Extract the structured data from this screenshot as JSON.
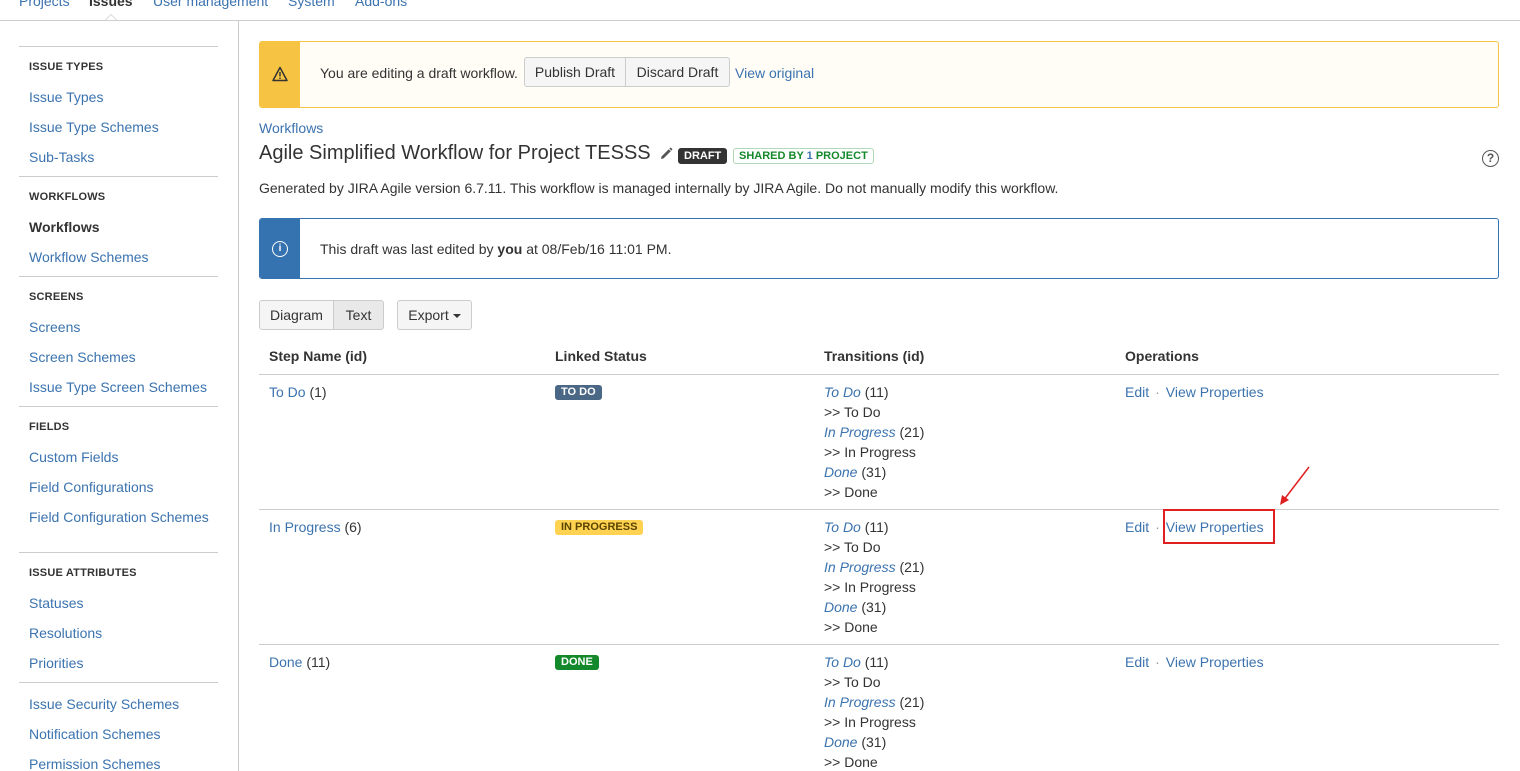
{
  "topnav": {
    "items": [
      "Projects",
      "Issues",
      "User management",
      "System",
      "Add-ons"
    ],
    "active_index": 1
  },
  "sidebar": {
    "sections": [
      {
        "title": "ISSUE TYPES",
        "items": [
          "Issue Types",
          "Issue Type Schemes",
          "Sub-Tasks"
        ]
      },
      {
        "title": "WORKFLOWS",
        "items": [
          "Workflows",
          "Workflow Schemes"
        ],
        "current": "Workflows"
      },
      {
        "title": "SCREENS",
        "items": [
          "Screens",
          "Screen Schemes",
          "Issue Type Screen Schemes"
        ]
      },
      {
        "title": "FIELDS",
        "items": [
          "Custom Fields",
          "Field Configurations",
          "Field Configuration Schemes"
        ]
      },
      {
        "title": "ISSUE ATTRIBUTES",
        "items": [
          "Statuses",
          "Resolutions",
          "Priorities"
        ]
      },
      {
        "title": "",
        "items": [
          "Issue Security Schemes",
          "Notification Schemes",
          "Permission Schemes"
        ]
      }
    ]
  },
  "draft_banner": {
    "message": "You are editing a draft workflow.",
    "publish_label": "Publish Draft",
    "discard_label": "Discard Draft",
    "view_original": "View original",
    "icon": "warning-icon",
    "color": "#f6c342"
  },
  "breadcrumb": "Workflows",
  "page": {
    "title": "Agile Simplified Workflow for Project TESSS",
    "draft_badge": "DRAFT",
    "shared_prefix": "SHARED BY ",
    "shared_count": "1",
    "shared_suffix": " PROJECT",
    "help_symbol": "?",
    "description": "Generated by JIRA Agile version 6.7.11. This workflow is managed internally by JIRA Agile. Do not manually modify this workflow."
  },
  "info_banner": {
    "prefix": "This draft was last edited by ",
    "user": "you",
    "suffix": " at 08/Feb/16 11:01 PM.",
    "icon_symbol": "i",
    "color": "#3572b0"
  },
  "view_toggle": {
    "diagram": "Diagram",
    "text": "Text",
    "export": "Export"
  },
  "table": {
    "headers": [
      "Step Name (id)",
      "Linked Status",
      "Transitions (id)",
      "Operations"
    ],
    "rows": [
      {
        "step": "To Do",
        "id": "(1)",
        "status": "TO DO",
        "transitions": [
          {
            "name": "To Do",
            "id": "(11)",
            "target": ">> To Do"
          },
          {
            "name": "In Progress",
            "id": "(21)",
            "target": ">> In Progress"
          },
          {
            "name": "Done",
            "id": "(31)",
            "target": ">> Done"
          }
        ],
        "ops": [
          "Edit",
          "View Properties"
        ]
      },
      {
        "step": "In Progress",
        "id": "(6)",
        "status": "IN PROGRESS",
        "transitions": [
          {
            "name": "To Do",
            "id": "(11)",
            "target": ">> To Do"
          },
          {
            "name": "In Progress",
            "id": "(21)",
            "target": ">> In Progress"
          },
          {
            "name": "Done",
            "id": "(31)",
            "target": ">> Done"
          }
        ],
        "ops": [
          "Edit",
          "View Properties"
        ]
      },
      {
        "step": "Done",
        "id": "(11)",
        "status": "DONE",
        "transitions": [
          {
            "name": "To Do",
            "id": "(11)",
            "target": ">> To Do"
          },
          {
            "name": "In Progress",
            "id": "(21)",
            "target": ">> In Progress"
          },
          {
            "name": "Done",
            "id": "(31)",
            "target": ">> Done"
          }
        ],
        "ops": [
          "Edit",
          "View Properties"
        ]
      }
    ],
    "status_colors": {
      "todo": "#4a6785",
      "progress": "#ffd351",
      "done": "#14892c"
    }
  },
  "annotation": {
    "color": "#e02020"
  }
}
